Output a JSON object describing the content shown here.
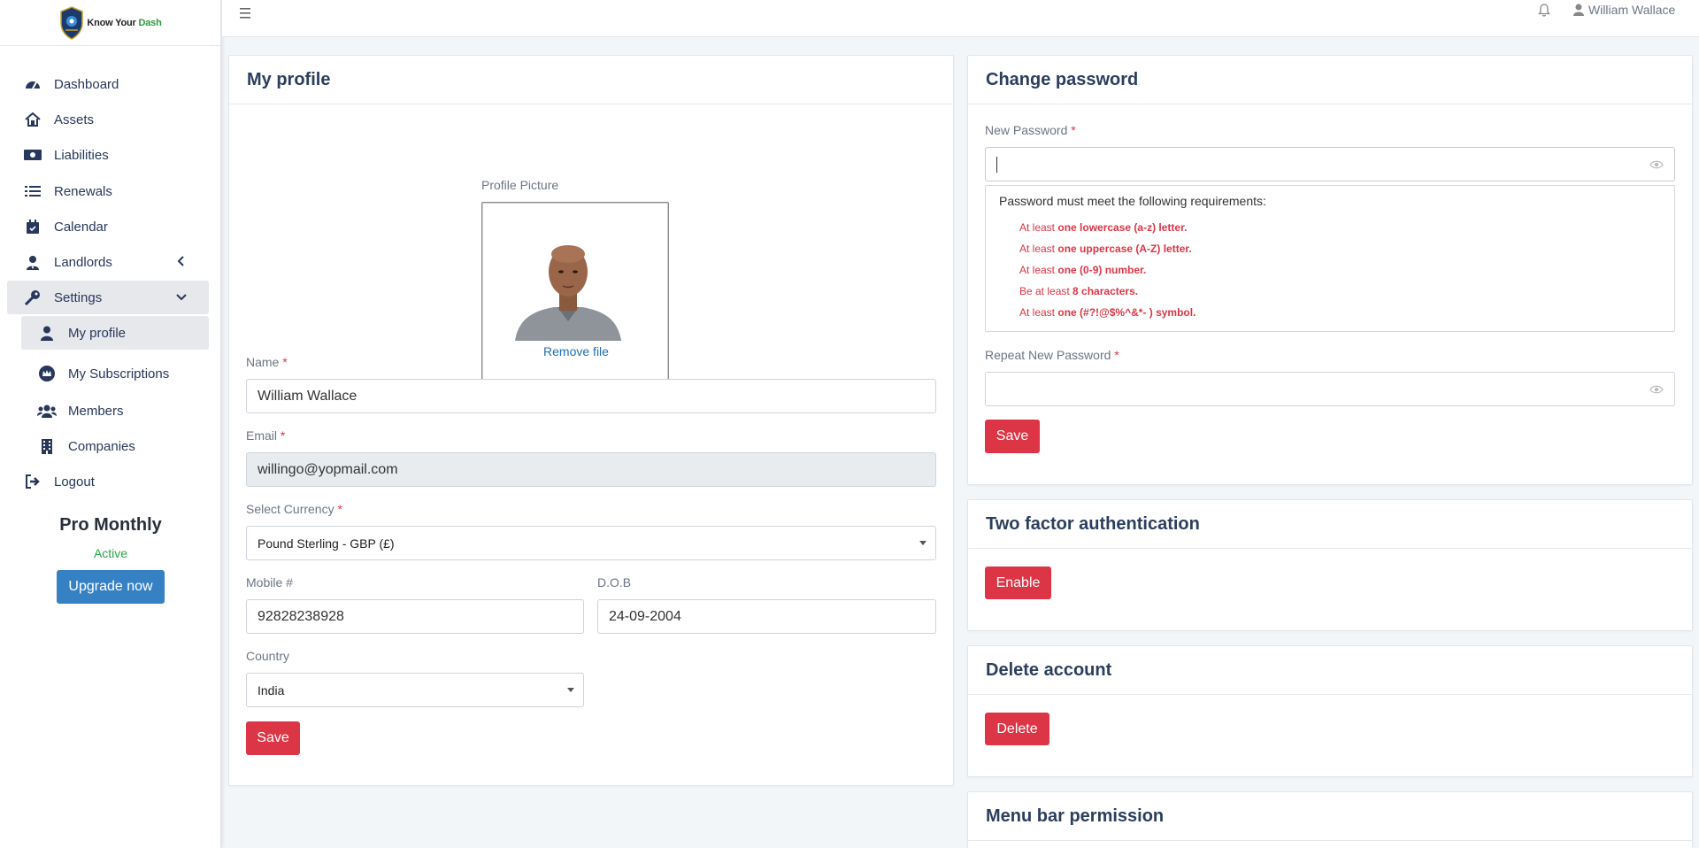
{
  "brand": {
    "name_prefix": "Know Your ",
    "name_accent": "Dash"
  },
  "topbar": {
    "user_name": "William Wallace"
  },
  "sidebar": {
    "items": [
      {
        "label": "Dashboard",
        "icon": "dashboard-icon"
      },
      {
        "label": "Assets",
        "icon": "home-icon"
      },
      {
        "label": "Liabilities",
        "icon": "money-icon"
      },
      {
        "label": "Renewals",
        "icon": "list-icon"
      },
      {
        "label": "Calendar",
        "icon": "calendar-icon"
      },
      {
        "label": "Landlords",
        "icon": "user-tie-icon"
      },
      {
        "label": "Settings",
        "icon": "key-icon"
      },
      {
        "label": "My profile",
        "icon": "user-icon"
      },
      {
        "label": "My Subscriptions",
        "icon": "crown-icon"
      },
      {
        "label": "Members",
        "icon": "users-icon"
      },
      {
        "label": "Companies",
        "icon": "building-icon"
      },
      {
        "label": "Logout",
        "icon": "logout-icon"
      }
    ],
    "plan": {
      "name": "Pro Monthly",
      "status": "Active",
      "upgrade_label": "Upgrade now"
    }
  },
  "profile": {
    "title": "My profile",
    "picture_label": "Profile Picture",
    "remove_file": "Remove file",
    "name_label": "Name",
    "name_value": "William Wallace",
    "email_label": "Email",
    "email_value": "willingo@yopmail.com",
    "currency_label": "Select Currency",
    "currency_value": "Pound Sterling - GBP (£)",
    "mobile_label": "Mobile #",
    "mobile_value": "92828238928",
    "dob_label": "D.O.B",
    "dob_value": "24-09-2004",
    "country_label": "Country",
    "country_value": "India",
    "save_label": "Save",
    "required_mark": "*"
  },
  "password": {
    "title": "Change password",
    "new_label": "New Password",
    "repeat_label": "Repeat New Password",
    "requirements_title": "Password must meet the following requirements:",
    "requirements": [
      {
        "prefix": "At least ",
        "bold": "one lowercase (a-z) letter."
      },
      {
        "prefix": "At least ",
        "bold": "one uppercase (A-Z) letter."
      },
      {
        "prefix": "At least ",
        "bold": "one (0-9) number."
      },
      {
        "prefix": "Be at least ",
        "bold": "8 characters."
      },
      {
        "prefix": "At least ",
        "bold": "one (#?!@$%^&*- ) symbol."
      }
    ],
    "save_label": "Save"
  },
  "two_factor": {
    "title": "Two factor authentication",
    "enable_label": "Enable"
  },
  "delete_account": {
    "title": "Delete account",
    "delete_label": "Delete"
  },
  "menu_permission": {
    "title": "Menu bar permission"
  },
  "colors": {
    "danger": "#dc3545",
    "primary": "#3581c4",
    "success": "#28a745",
    "heading": "#2b3e5e"
  }
}
